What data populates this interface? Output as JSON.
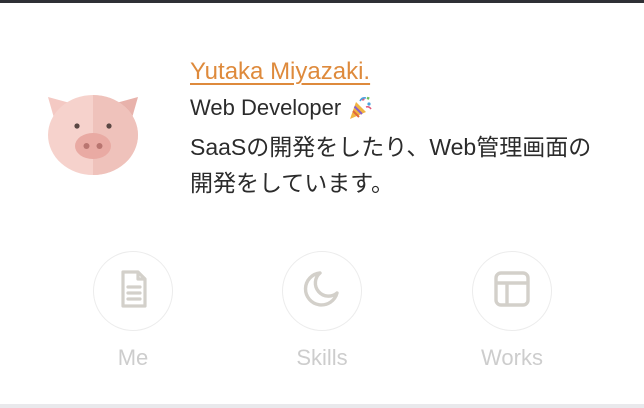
{
  "profile": {
    "name": "Yutaka Miyazaki.",
    "role": "Web Developer",
    "role_emoji": "party-popper-icon",
    "description": "SaaSの開発をしたり、Web管理画面の開発をしています。",
    "avatar": "pig-avatar-icon"
  },
  "nav": {
    "items": [
      {
        "label": "Me",
        "icon": "document-icon"
      },
      {
        "label": "Skills",
        "icon": "moon-icon"
      },
      {
        "label": "Works",
        "icon": "layout-icon"
      }
    ]
  },
  "colors": {
    "link": "#de8a3c",
    "text": "#2b2b2b",
    "nav_icon": "#d3d0ca",
    "nav_label": "#cdcdcd",
    "pig_face": "#f3c8c2",
    "pig_snout": "#e8a8a2"
  }
}
